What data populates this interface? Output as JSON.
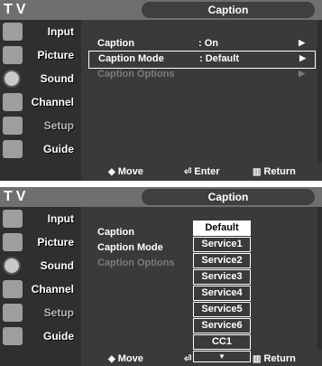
{
  "brand": "TV",
  "menu_title": "Caption",
  "sidebar": [
    {
      "label": "Input",
      "icon": "input-icon",
      "dim": false
    },
    {
      "label": "Picture",
      "icon": "picture-icon",
      "dim": false
    },
    {
      "label": "Sound",
      "icon": "sound-icon",
      "dim": false
    },
    {
      "label": "Channel",
      "icon": "channel-icon",
      "dim": false
    },
    {
      "label": "Setup",
      "icon": "setup-icon",
      "dim": true
    },
    {
      "label": "Guide",
      "icon": "guide-icon",
      "dim": false
    }
  ],
  "menu_rows": [
    {
      "label": "Caption",
      "value": ": On",
      "arrow": "▶"
    },
    {
      "label": "Caption Mode",
      "value": ": Default",
      "arrow": "▶"
    },
    {
      "label": "Caption Options",
      "value": "",
      "arrow": "▶"
    }
  ],
  "menu_rows_panel2": [
    {
      "label": "Caption",
      "value": ":"
    },
    {
      "label": "Caption Mode",
      "value": ":"
    },
    {
      "label": "Caption Options",
      "value": ""
    }
  ],
  "footer": {
    "move": "Move",
    "enter": "Enter",
    "return": "Return",
    "move_icon": "◆",
    "enter_icon": "⏎",
    "return_icon": "▥"
  },
  "dropdown": {
    "options": [
      "Default",
      "Service1",
      "Service2",
      "Service3",
      "Service4",
      "Service5",
      "Service6",
      "CC1"
    ],
    "selected": "Default",
    "more": "▼"
  }
}
